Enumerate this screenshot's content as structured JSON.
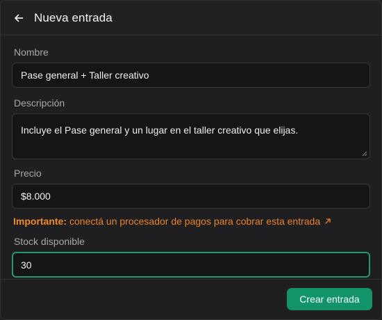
{
  "header": {
    "title": "Nueva entrada",
    "back_icon": "arrow-left-icon"
  },
  "form": {
    "name": {
      "label": "Nombre",
      "value": "Pase general + Taller creativo"
    },
    "description": {
      "label": "Descripción",
      "value": "Incluye el Pase general y un lugar en el taller creativo que elijas."
    },
    "price": {
      "label": "Precio",
      "value": "$8.000"
    },
    "notice": {
      "strong": "Importante:",
      "text": "conectá un procesador de pagos para cobrar esta entrada",
      "icon": "external-link-arrow-icon"
    },
    "stock": {
      "label": "Stock disponible",
      "value": "30"
    }
  },
  "footer": {
    "submit_label": "Crear entrada"
  },
  "colors": {
    "accent": "#12936a",
    "focus_border": "#1f9a72",
    "warning": "#e8832a",
    "background": "#1f1f21",
    "field_bg": "#151517"
  }
}
